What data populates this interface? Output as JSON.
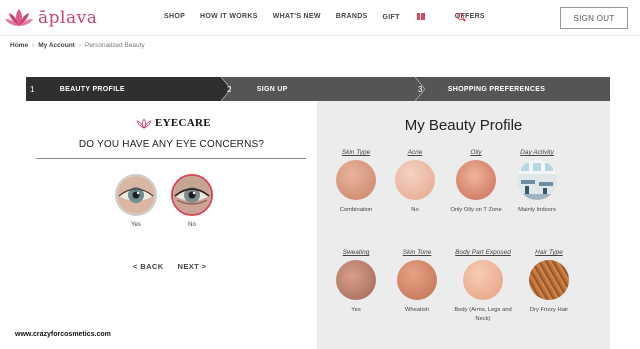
{
  "brand": {
    "name": "āplava"
  },
  "nav": {
    "items": [
      "SHOP",
      "HOW IT WORKS",
      "WHAT'S NEW",
      "BRANDS",
      "GIFT",
      "OFFERS"
    ],
    "signout": "SIGN OUT"
  },
  "breadcrumb": [
    "Home",
    "My Account",
    "Personalized Beauty"
  ],
  "steps": [
    {
      "num": "1",
      "label": "BEAUTY PROFILE"
    },
    {
      "num": "2",
      "label": "SIGN UP"
    },
    {
      "num": "3",
      "label": "SHOPPING PREFERENCES"
    }
  ],
  "eyecare": {
    "title": "EYECARE",
    "question": "DO YOU HAVE ANY EYE CONCERNS?",
    "options": [
      "Yes",
      "No"
    ],
    "selected": "No",
    "back": "< BACK",
    "next": "NEXT >"
  },
  "profile": {
    "title": "My Beauty Profile",
    "attributes": [
      {
        "head": "Skin Type",
        "value": "Combination"
      },
      {
        "head": "Acne",
        "value": "No"
      },
      {
        "head": "Oily",
        "value": "Only Oily on T Zone"
      },
      {
        "head": "Day Activity",
        "value": "Mainly Indoors"
      },
      {
        "head": "Sweating",
        "value": "Yes"
      },
      {
        "head": "Skin Tone",
        "value": "Wheatish"
      },
      {
        "head": "Body Part Exposed",
        "value": "Body (Arms, Legs and Neck)"
      },
      {
        "head": "Hair Type",
        "value": "Dry Frizzy Hair"
      }
    ]
  },
  "watermark": "www.crazyforcosmetics.com",
  "colors": {
    "accent": "#d9475f",
    "step_active": "#2f2f2f",
    "step_bar": "#555555",
    "panel": "#ececec"
  }
}
